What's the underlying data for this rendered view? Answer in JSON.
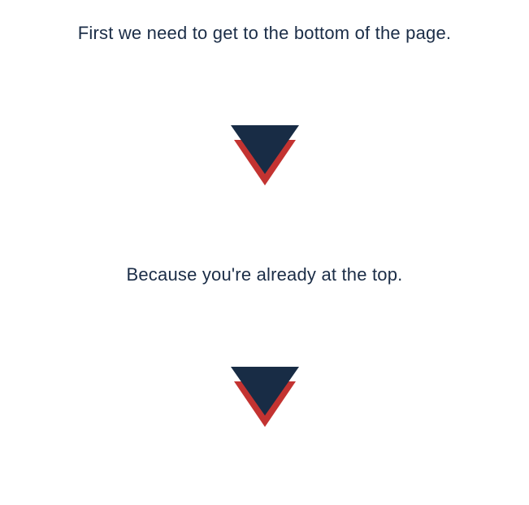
{
  "lines": {
    "first": "First we need to get to the bottom of the page.",
    "second": "Because you're already at the top."
  },
  "colors": {
    "text": "#1b2d47",
    "arrowFront": "#182c45",
    "arrowBack": "#c33331"
  }
}
